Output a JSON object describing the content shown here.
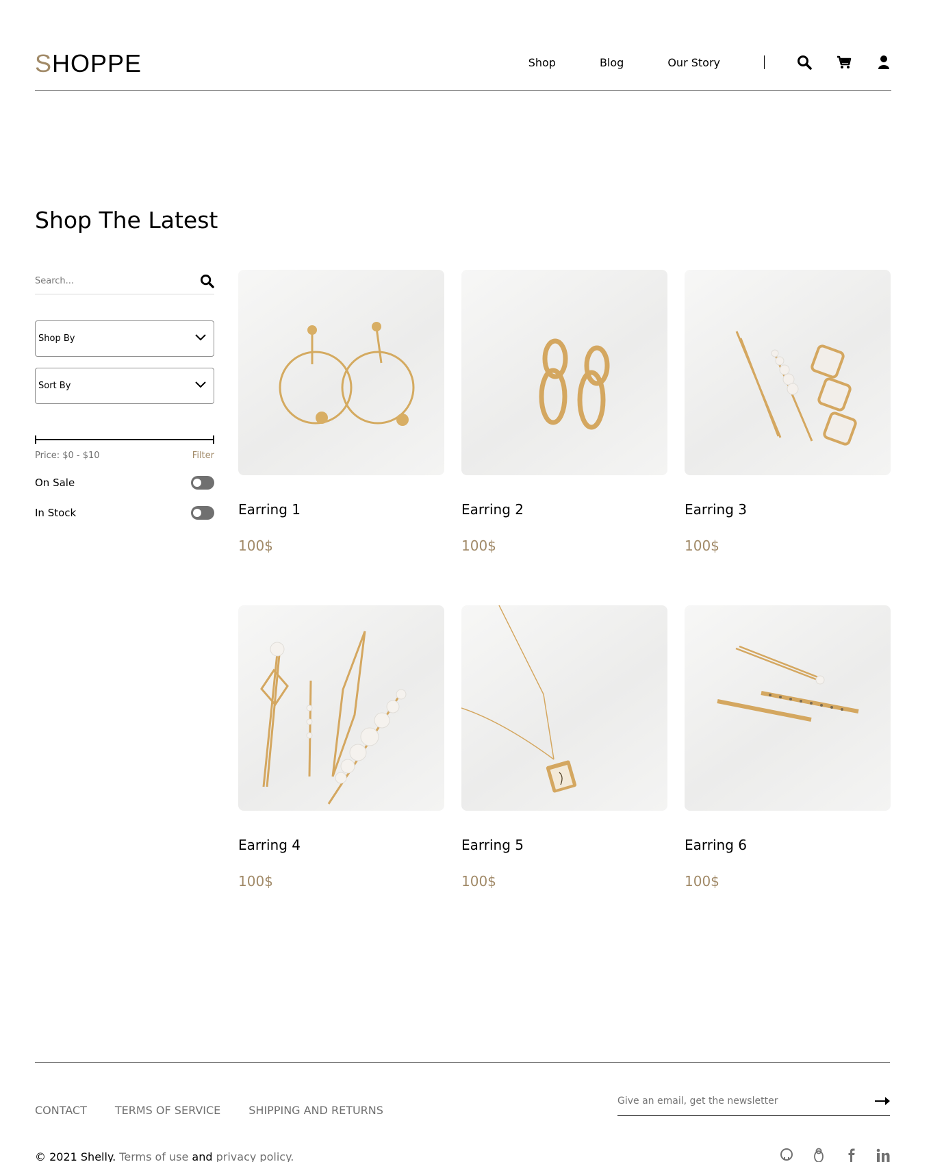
{
  "brand": {
    "logo_first": "S",
    "logo_rest": "HOPPE",
    "accent": "#a18a68"
  },
  "nav": {
    "items": [
      "Shop",
      "Blog",
      "Our Story"
    ],
    "icons": [
      "search-icon",
      "cart-icon",
      "user-icon"
    ]
  },
  "page": {
    "title": "Shop The Latest"
  },
  "filters": {
    "search_placeholder": "Search...",
    "shop_by": "Shop By",
    "sort_by": "Sort By",
    "price_label": "Price: $0 - $10",
    "filter_label": "Filter",
    "on_sale": "On Sale",
    "in_stock": "In Stock"
  },
  "products": [
    {
      "name": "Earring 1",
      "price": "100$"
    },
    {
      "name": "Earring 2",
      "price": "100$"
    },
    {
      "name": "Earring 3",
      "price": "100$"
    },
    {
      "name": "Earring 4",
      "price": "100$"
    },
    {
      "name": "Earring 5",
      "price": "100$"
    },
    {
      "name": "Earring 6",
      "price": "100$"
    }
  ],
  "footer": {
    "links": [
      "CONTACT",
      "TERMS OF SERVICE",
      "SHIPPING AND RETURNS"
    ],
    "newsletter_placeholder": "Give an email, get the newsletter",
    "copyright_prefix": "© 2021 Shelly.",
    "terms": "Terms of use",
    "and": "and",
    "privacy": "privacy policy.",
    "social_icons": [
      "github-icon",
      "linux-icon",
      "facebook-icon",
      "linkedin-icon"
    ]
  }
}
